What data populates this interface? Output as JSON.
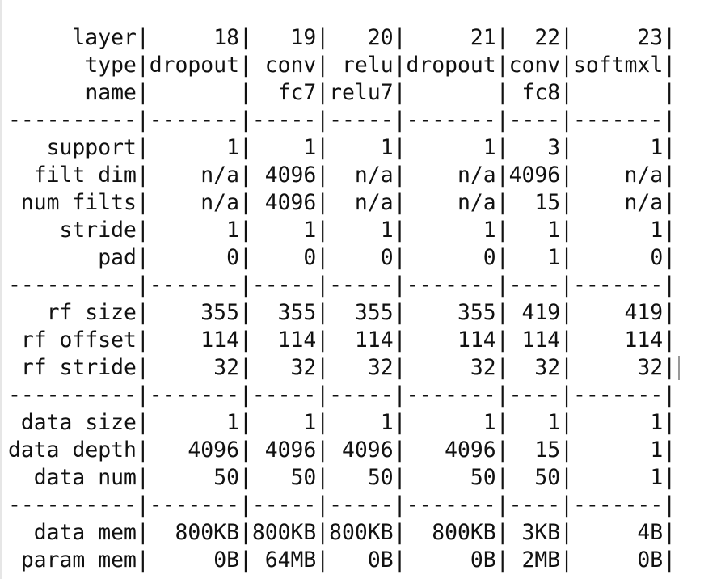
{
  "col_widths": [
    10,
    7,
    5,
    5,
    7,
    4,
    7
  ],
  "rows": [
    {
      "kind": "data",
      "cells": [
        "layer",
        "18",
        "19",
        "20",
        "21",
        "22",
        "23"
      ]
    },
    {
      "kind": "data",
      "cells": [
        "type",
        "dropout",
        "conv",
        "relu",
        "dropout",
        "conv",
        "softmxl"
      ]
    },
    {
      "kind": "data",
      "cells": [
        "name",
        "",
        "fc7",
        "relu7",
        "",
        "fc8",
        ""
      ]
    },
    {
      "kind": "rule"
    },
    {
      "kind": "data",
      "cells": [
        "support",
        "1",
        "1",
        "1",
        "1",
        "3",
        "1"
      ]
    },
    {
      "kind": "data",
      "cells": [
        "filt dim",
        "n/a",
        "4096",
        "n/a",
        "n/a",
        "4096",
        "n/a"
      ]
    },
    {
      "kind": "data",
      "cells": [
        "num filts",
        "n/a",
        "4096",
        "n/a",
        "n/a",
        "15",
        "n/a"
      ]
    },
    {
      "kind": "data",
      "cells": [
        "stride",
        "1",
        "1",
        "1",
        "1",
        "1",
        "1"
      ]
    },
    {
      "kind": "data",
      "cells": [
        "pad",
        "0",
        "0",
        "0",
        "0",
        "1",
        "0"
      ]
    },
    {
      "kind": "rule"
    },
    {
      "kind": "data",
      "cells": [
        "rf size",
        "355",
        "355",
        "355",
        "355",
        "419",
        "419"
      ]
    },
    {
      "kind": "data",
      "cells": [
        "rf offset",
        "114",
        "114",
        "114",
        "114",
        "114",
        "114"
      ]
    },
    {
      "kind": "data",
      "cells": [
        "rf stride",
        "32",
        "32",
        "32",
        "32",
        "32",
        "32"
      ],
      "cursor": true
    },
    {
      "kind": "rule"
    },
    {
      "kind": "data",
      "cells": [
        "data size",
        "1",
        "1",
        "1",
        "1",
        "1",
        "1"
      ]
    },
    {
      "kind": "data",
      "cells": [
        "data depth",
        "4096",
        "4096",
        "4096",
        "4096",
        "15",
        "1"
      ]
    },
    {
      "kind": "data",
      "cells": [
        "data num",
        "50",
        "50",
        "50",
        "50",
        "50",
        "1"
      ]
    },
    {
      "kind": "rule"
    },
    {
      "kind": "data",
      "cells": [
        "data mem",
        "800KB",
        "800KB",
        "800KB",
        "800KB",
        "3KB",
        "4B"
      ]
    },
    {
      "kind": "data",
      "cells": [
        "param mem",
        "0B",
        "64MB",
        "0B",
        "0B",
        "2MB",
        "0B"
      ]
    }
  ]
}
